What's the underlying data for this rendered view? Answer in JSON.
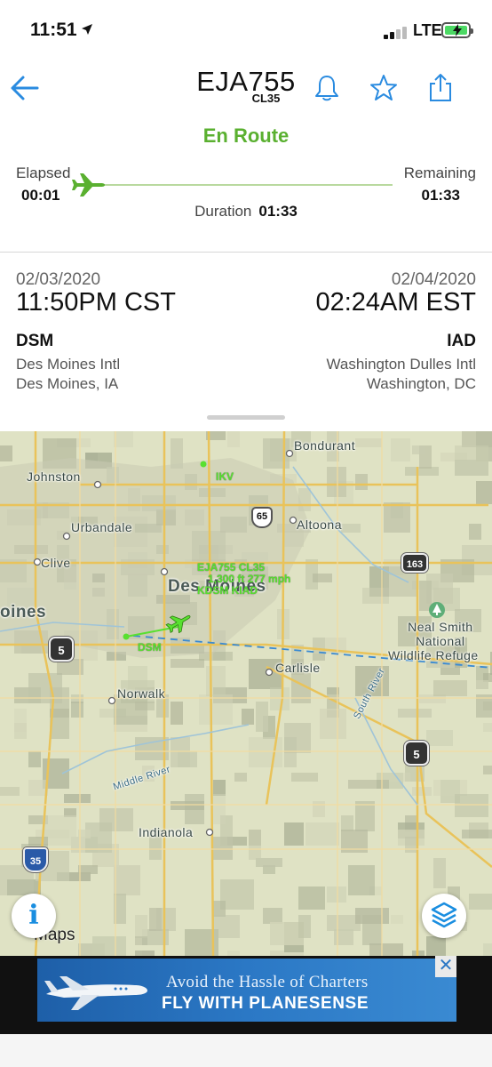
{
  "status_bar": {
    "time": "11:51",
    "network": "LTE",
    "battery_color": "#4cd964"
  },
  "header": {
    "flight_id": "EJA755",
    "aircraft_type": "CL35",
    "icons": [
      "back-arrow-icon",
      "bell-icon",
      "star-icon",
      "share-icon"
    ]
  },
  "status": {
    "label": "En Route",
    "color": "#5ab030"
  },
  "progress": {
    "elapsed_label": "Elapsed",
    "elapsed_value": "00:01",
    "remaining_label": "Remaining",
    "remaining_value": "01:33",
    "duration_label": "Duration",
    "duration_value": "01:33",
    "fraction": 0.01
  },
  "departure": {
    "date": "02/03/2020",
    "time": "11:50PM CST",
    "code": "DSM",
    "airport": "Des Moines Intl",
    "city": "Des Moines, IA"
  },
  "arrival": {
    "date": "02/04/2020",
    "time": "02:24AM EST",
    "code": "IAD",
    "airport": "Washington Dulles Intl",
    "city": "Washington, DC"
  },
  "map": {
    "places": {
      "bondurant": "Bondurant",
      "johnston": "Johnston",
      "ikv": "IKV",
      "altoona": "Altoona",
      "urbandale": "Urbandale",
      "clive": "Clive",
      "des_moines": "Des Moines",
      "moines_edge": "oines",
      "neal_smith_1": "Neal Smith",
      "neal_smith_2": "National",
      "neal_smith_3": "Wildlife Refuge",
      "dsm": "DSM",
      "carlisle": "Carlisle",
      "norwalk": "Norwalk",
      "south_river": "South River",
      "middle_river": "Middle River",
      "indianola": "Indianola"
    },
    "flight_tag": {
      "line1": "EJA755 CL35",
      "line2": "1,300 ft 277 mph",
      "line3": "KDSM KIAD"
    },
    "shields": {
      "us65": "65",
      "hwy163": "163",
      "hwy5_west": "5",
      "hwy5_east": "5",
      "i35": "35"
    },
    "credit": "Maps",
    "route_color": "#3a8ad2",
    "track_color": "#58e030"
  },
  "ad": {
    "line1": "Avoid the Hassle of Charters",
    "line2": "FLY WITH PLANESENSE",
    "close": "✕"
  }
}
